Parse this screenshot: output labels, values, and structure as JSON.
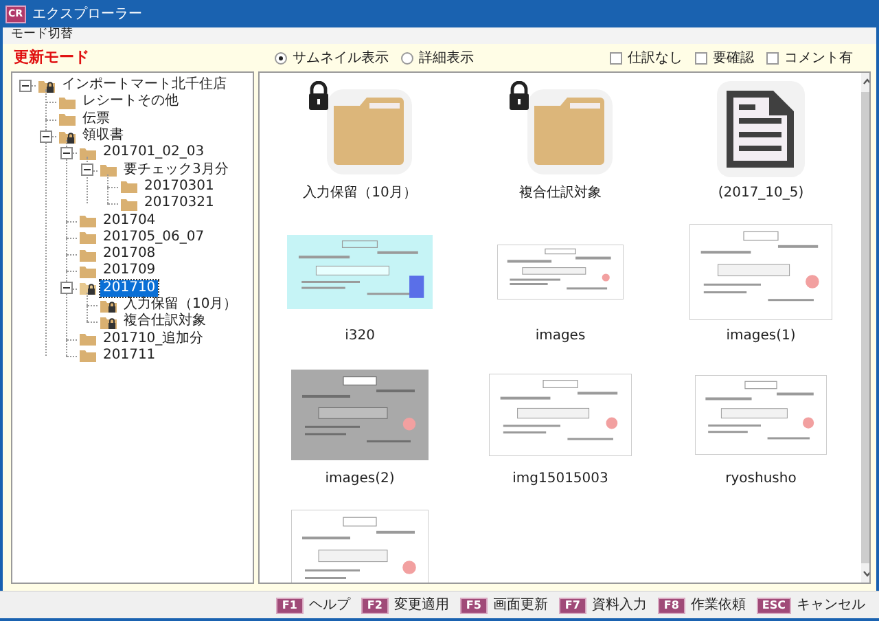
{
  "window": {
    "title": "エクスプローラー",
    "app_icon": "CR"
  },
  "menu": [
    "モード切替"
  ],
  "mode_label": "更新モード",
  "view_options": [
    {
      "label": "サムネイル表示",
      "selected": true
    },
    {
      "label": "詳細表示",
      "selected": false
    }
  ],
  "filters": [
    {
      "label": "仕訳なし",
      "checked": false
    },
    {
      "label": "要確認",
      "checked": false
    },
    {
      "label": "コメント有",
      "checked": false
    }
  ],
  "tree": [
    {
      "label": "インポートマート北千住店",
      "locked": true,
      "expanded": true,
      "selected": false,
      "children": [
        {
          "label": "レシートその他",
          "locked": false,
          "selected": false
        },
        {
          "label": "伝票",
          "locked": false,
          "selected": false
        },
        {
          "label": "領収書",
          "locked": true,
          "expanded": true,
          "selected": false,
          "children": [
            {
              "label": "201701_02_03",
              "locked": false,
              "expanded": true,
              "selected": false,
              "children": [
                {
                  "label": "要チェック3月分",
                  "locked": false,
                  "expanded": true,
                  "selected": false,
                  "children": [
                    {
                      "label": "20170301",
                      "locked": false,
                      "selected": false
                    },
                    {
                      "label": "20170321",
                      "locked": false,
                      "selected": false
                    }
                  ]
                }
              ]
            },
            {
              "label": "201704",
              "locked": false,
              "selected": false
            },
            {
              "label": "201705_06_07",
              "locked": false,
              "selected": false
            },
            {
              "label": "201708",
              "locked": false,
              "selected": false
            },
            {
              "label": "201709",
              "locked": false,
              "selected": false
            },
            {
              "label": "201710",
              "locked": true,
              "expanded": true,
              "selected": true,
              "children": [
                {
                  "label": "入力保留（10月）",
                  "locked": true,
                  "selected": false
                },
                {
                  "label": "複合仕訳対象",
                  "locked": true,
                  "selected": false
                }
              ]
            },
            {
              "label": "201710_追加分",
              "locked": false,
              "selected": false
            },
            {
              "label": "201711",
              "locked": false,
              "selected": false
            }
          ]
        }
      ]
    }
  ],
  "thumbnails": [
    {
      "kind": "folder",
      "label": "入力保留（10月）",
      "locked": true
    },
    {
      "kind": "folder",
      "label": "複合仕訳対象",
      "locked": true
    },
    {
      "kind": "file",
      "label": "(2017_10_5)"
    },
    {
      "kind": "picture",
      "label": "i320"
    },
    {
      "kind": "picture",
      "label": "images"
    },
    {
      "kind": "picture",
      "label": "images(1)"
    },
    {
      "kind": "picture",
      "label": "images(2)"
    },
    {
      "kind": "picture",
      "label": "img15015003"
    },
    {
      "kind": "picture",
      "label": "ryoshusho"
    },
    {
      "kind": "picture"
    }
  ],
  "function_keys": [
    {
      "key": "F1",
      "label": "ヘルプ"
    },
    {
      "key": "F2",
      "label": "変更適用"
    },
    {
      "key": "F5",
      "label": "画面更新"
    },
    {
      "key": "F7",
      "label": "資料入力"
    },
    {
      "key": "F8",
      "label": "作業依頼"
    },
    {
      "key": "ESC",
      "label": "キャンセル"
    }
  ]
}
